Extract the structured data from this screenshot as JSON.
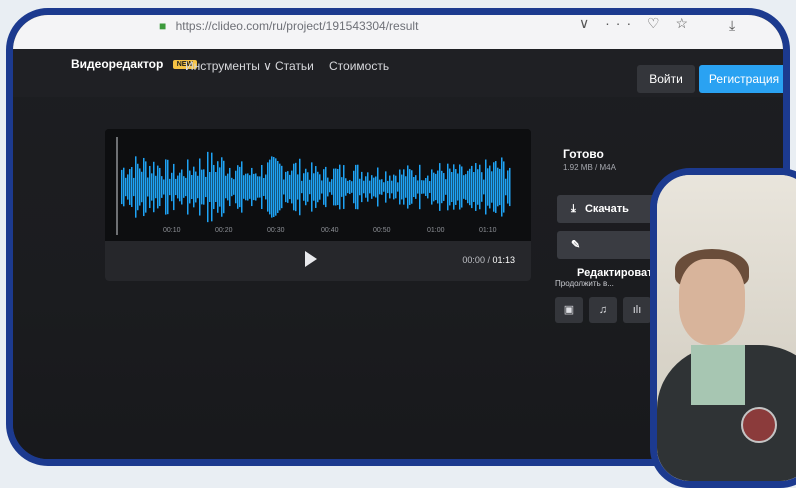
{
  "browser": {
    "url": "https://clideo.com/ru/project/191543304/result",
    "controls": "∨ ··· ♡ ☆",
    "download_glyph": "⤓"
  },
  "nav": {
    "logo": "Видеоредактор",
    "new_badge": "NEW",
    "tools": "Инструменты ∨",
    "articles": "Статьи",
    "pricing": "Стоимость",
    "login": "Войти",
    "register": "Регистрация"
  },
  "player": {
    "ticks": [
      "00:10",
      "00:20",
      "00:30",
      "00:40",
      "00:50",
      "01:00",
      "01:10"
    ],
    "time_current": "00:00",
    "time_sep": " / ",
    "time_total": "01:13",
    "wave_color": "#1ea3f5"
  },
  "result": {
    "status": "Готово",
    "meta": "1.92 MB / M4A",
    "download_icon": "⤓",
    "download_label": "Скачать",
    "edit_icon": "✎",
    "edit_label": "Редактировать",
    "continue_label": "Продолжить в...",
    "continue_icons": [
      "▣",
      "♫",
      "ılı"
    ]
  },
  "colors": {
    "frame": "#1c3a8f",
    "accent": "#2aa2f2",
    "badge": "#f6c344"
  }
}
